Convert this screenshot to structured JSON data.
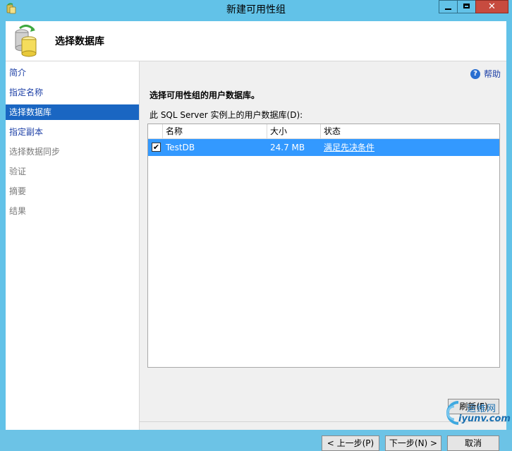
{
  "window": {
    "title": "新建可用性组",
    "close_glyph": "✕"
  },
  "header": {
    "title": "选择数据库"
  },
  "sidebar": {
    "items": [
      {
        "label": "简介",
        "state": "link"
      },
      {
        "label": "指定名称",
        "state": "link"
      },
      {
        "label": "选择数据库",
        "state": "active"
      },
      {
        "label": "指定副本",
        "state": "link"
      },
      {
        "label": "选择数据同步",
        "state": "dim"
      },
      {
        "label": "验证",
        "state": "dim"
      },
      {
        "label": "摘要",
        "state": "dim"
      },
      {
        "label": "结果",
        "state": "dim"
      }
    ]
  },
  "main": {
    "help_label": "帮助",
    "help_icon_glyph": "?",
    "subtitle": "选择可用性组的用户数据库。",
    "list_label": "此 SQL Server 实例上的用户数据库(D):",
    "columns": [
      "名称",
      "大小",
      "状态"
    ],
    "rows": [
      {
        "checked": true,
        "check_glyph": "✔",
        "name": "TestDB",
        "size": "24.7 MB",
        "status": "满足先决条件"
      }
    ],
    "refresh_label": "刷新(F)"
  },
  "footer": {
    "prev_label": "< 上一步(P)",
    "next_label": "下一步(N) >",
    "cancel_label": "取消"
  },
  "watermark": {
    "line1": "运维网",
    "line2": "iyunv.com"
  },
  "colors": {
    "frame": "#62c2e8",
    "selection": "#3399ff",
    "nav_active": "#1a66c2",
    "link": "#1c3fa6",
    "close_button": "#c74b3f"
  }
}
